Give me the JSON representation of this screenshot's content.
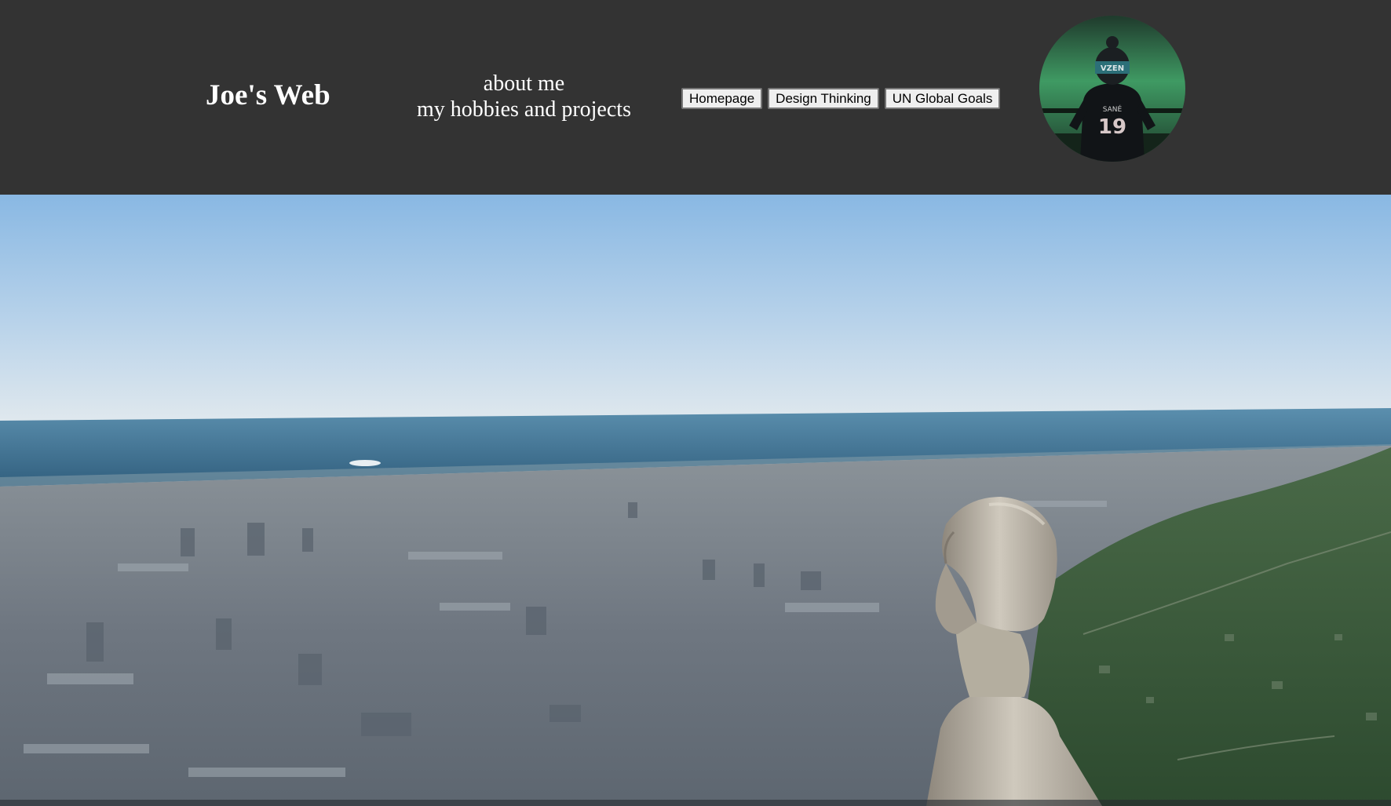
{
  "header": {
    "site_title": "Joe's Web",
    "subtitle_line1": "about me",
    "subtitle_line2": "my hobbies and projects",
    "background": "#333333"
  },
  "nav": {
    "buttons": [
      {
        "label": "Homepage"
      },
      {
        "label": "Design Thinking"
      },
      {
        "label": "UN Global Goals"
      }
    ]
  },
  "avatar": {
    "jersey_name": "SANÉ",
    "jersey_number": "19",
    "beanie_text": "VZEN"
  },
  "hero": {
    "description_colors": {
      "sky_top": "#8cbbe4",
      "sky_horizon": "#dfe7ec",
      "sea": "#3d7090",
      "city": "#6b7785",
      "hills": "#3c5a3a",
      "statue": "#b9b3a8"
    }
  }
}
